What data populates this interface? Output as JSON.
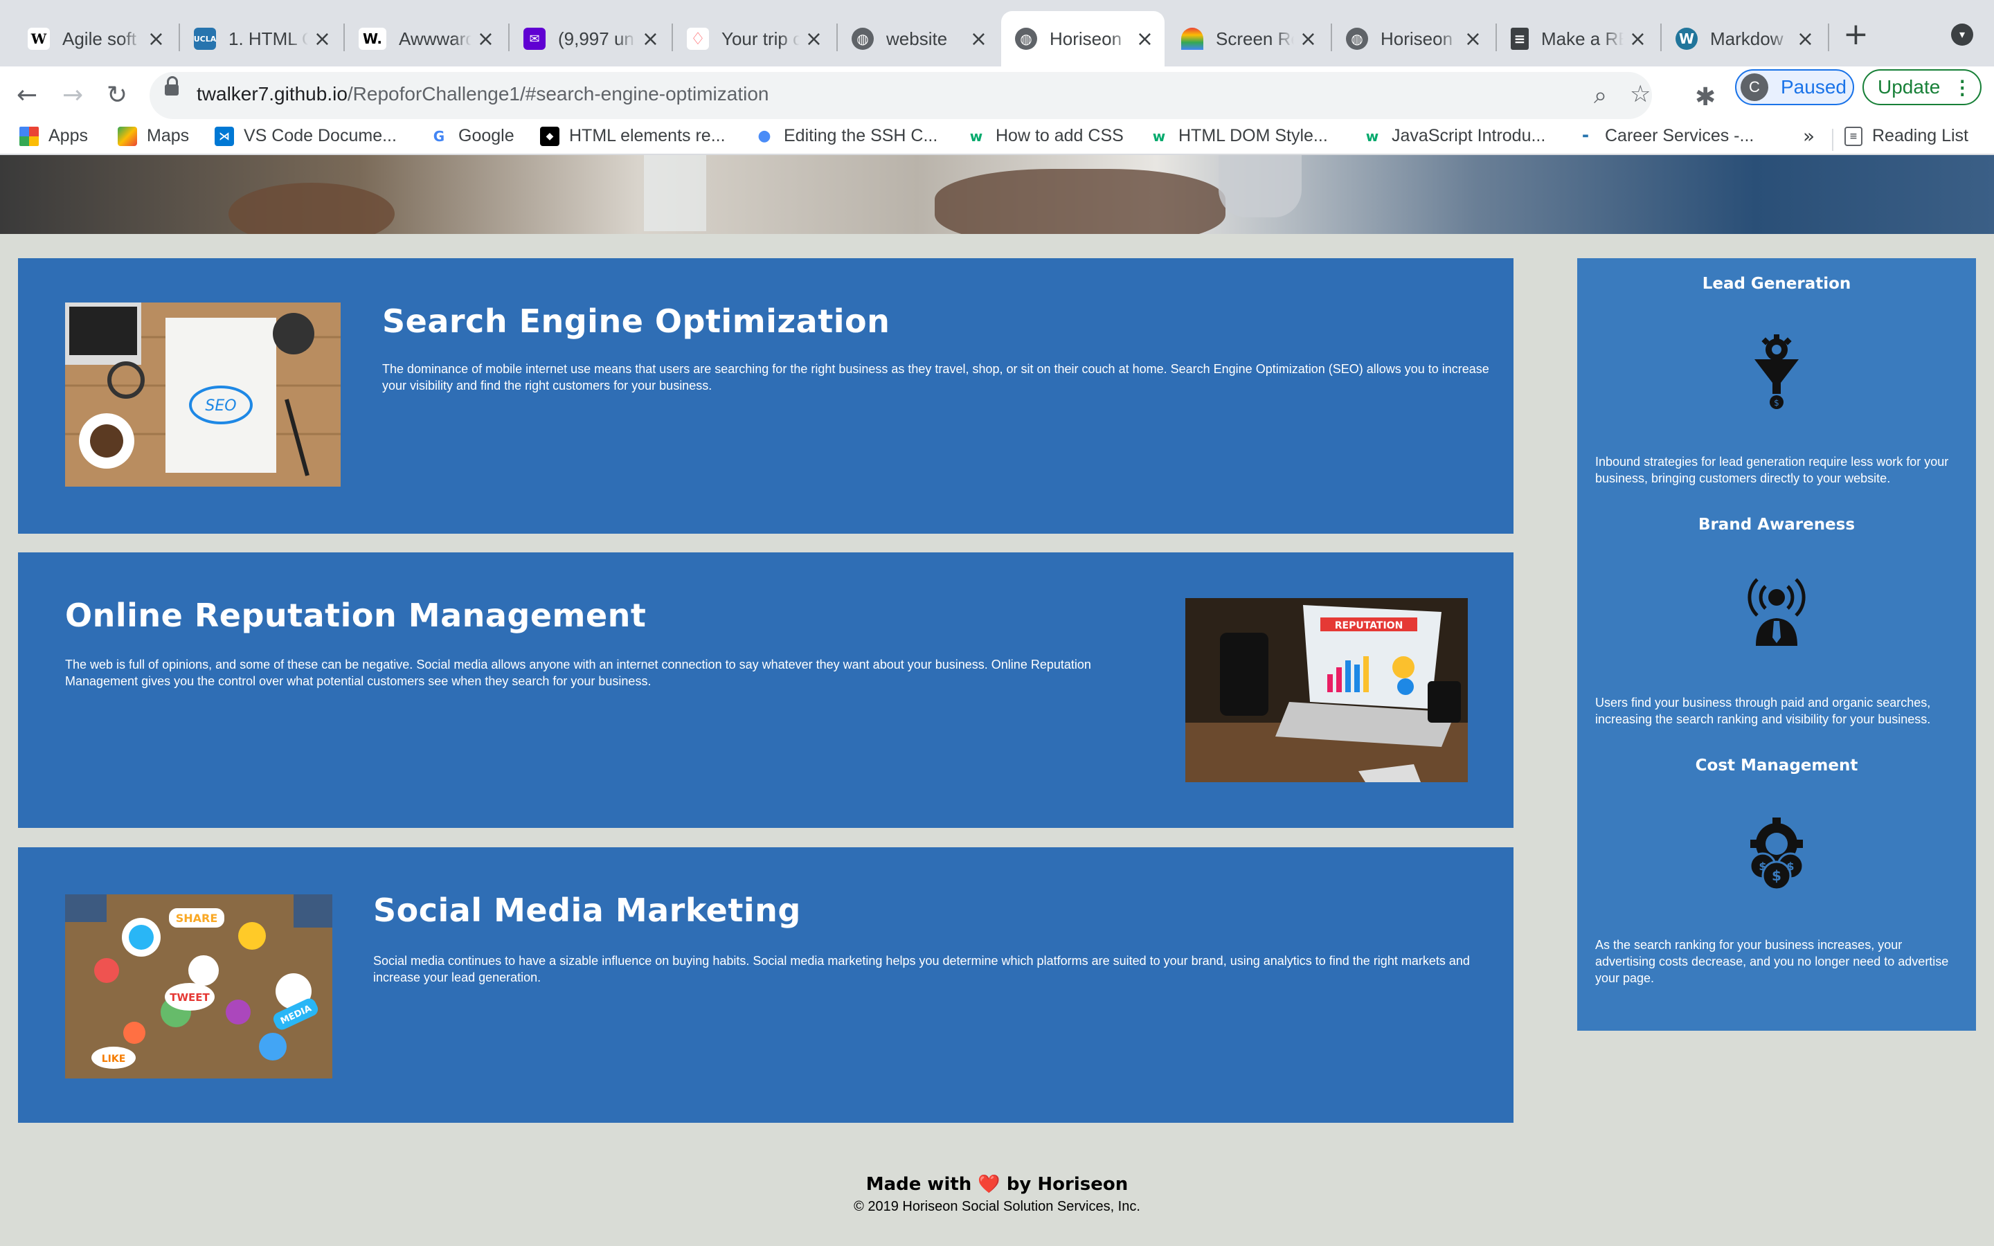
{
  "browser": {
    "tabs": [
      {
        "label": "Agile soft",
        "icon": "wikipedia-icon"
      },
      {
        "label": "1. HTML C",
        "icon": "ucla-icon"
      },
      {
        "label": "Awwward",
        "icon": "awwwards-icon"
      },
      {
        "label": "(9,997 un",
        "icon": "mail-icon"
      },
      {
        "label": "Your trip c",
        "icon": "airbnb-icon"
      },
      {
        "label": "website",
        "icon": "globe-icon"
      },
      {
        "label": "Horiseon",
        "icon": "globe-icon"
      },
      {
        "label": "Screen Re",
        "icon": "rainbow-icon"
      },
      {
        "label": "Horiseon",
        "icon": "globe-icon"
      },
      {
        "label": "Make a RE",
        "icon": "document-icon"
      },
      {
        "label": "Markdow",
        "icon": "wordpress-icon"
      }
    ],
    "url_host": "twalker7.github.io",
    "url_path": "/RepoforChallenge1/#search-engine-optimization",
    "profile_initial": "C",
    "profile_label": "Paused",
    "update_label": "Update",
    "bookmarks": [
      {
        "label": "Apps",
        "icon": "apps-grid-icon"
      },
      {
        "label": "Maps",
        "icon": "maps-icon"
      },
      {
        "label": "VS Code Docume...",
        "icon": "vscode-icon"
      },
      {
        "label": "Google",
        "icon": "google-icon"
      },
      {
        "label": "HTML elements re...",
        "icon": "mdn-icon"
      },
      {
        "label": "Editing the SSH C...",
        "icon": "apple-icon"
      },
      {
        "label": "How to add CSS",
        "icon": "w3schools-icon"
      },
      {
        "label": "HTML DOM Style...",
        "icon": "w3schools-icon"
      },
      {
        "label": "JavaScript Introdu...",
        "icon": "w3schools-icon"
      },
      {
        "label": "Career Services -...",
        "icon": "career-icon"
      }
    ],
    "bookmarks_more": "»",
    "reading_list": "Reading List"
  },
  "content": {
    "seo": {
      "title": "Search Engine Optimization",
      "text": "The dominance of mobile internet use means that users are searching for the right business as they travel, shop, or sit on their couch at home. Search Engine Optimization (SEO) allows you to increase your visibility and find the right customers for your business."
    },
    "orm": {
      "title": "Online Reputation Management",
      "text": "The web is full of opinions, and some of these can be negative. Social media allows anyone with an internet connection to say whatever they want about your business. Online Reputation Management gives you the control over what potential customers see when they search for your business."
    },
    "smm": {
      "title": "Social Media Marketing",
      "text": "Social media continues to have a sizable influence on buying habits. Social media marketing helps you determine which platforms are suited to your brand, using analytics to find the right markets and increase your lead generation."
    }
  },
  "benefits": [
    {
      "title": "Lead Generation",
      "icon": "lead-funnel-icon",
      "text": "Inbound strategies for lead generation require less work for your business, bringing customers directly to your website."
    },
    {
      "title": "Brand Awareness",
      "icon": "brand-broadcast-icon",
      "text": "Users find your business through paid and organic searches, increasing the search ranking and visibility for your business."
    },
    {
      "title": "Cost Management",
      "icon": "cost-gear-icon",
      "text": "As the search ranking for your business increases, your advertising costs decrease, and you no longer need to advertise your page."
    }
  ],
  "footer": {
    "made_prefix": "Made with",
    "heart": "❤️",
    "made_suffix": "by Horiseon",
    "copyright": "© 2019 Horiseon Social Solution Services, Inc."
  }
}
